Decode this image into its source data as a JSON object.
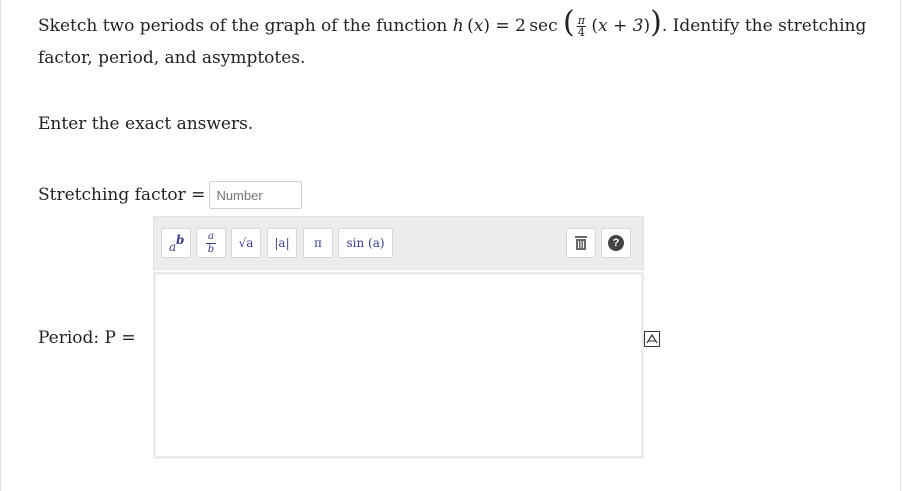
{
  "question": {
    "sentence_start": "Sketch two periods of the graph of the function",
    "function_name": "h",
    "variable": "x",
    "coefficient": "2",
    "trig": "sec",
    "frac_num": "π",
    "frac_den": "4",
    "inner": "x + 3",
    "sentence_end": ". Identify the stretching",
    "line2": "factor, period, and asymptotes."
  },
  "instruction": "Enter the exact answers.",
  "stretching_factor": {
    "label": "Stretching factor =",
    "placeholder": "Number"
  },
  "toolbar": {
    "buttons": [
      {
        "name": "power",
        "base": "a",
        "exp": "b"
      },
      {
        "name": "fraction",
        "num": "a",
        "den": "b"
      },
      {
        "name": "sqrt",
        "label": "√a"
      },
      {
        "name": "abs",
        "label": "|a|"
      },
      {
        "name": "pi",
        "label": "π"
      },
      {
        "name": "sin",
        "label": "sin (a)"
      }
    ],
    "help_label": "?"
  },
  "period": {
    "label": "Period: P ="
  },
  "icons": {
    "delete": "trash-icon",
    "help": "help-icon",
    "equation_editor": "equation-editor-icon"
  }
}
